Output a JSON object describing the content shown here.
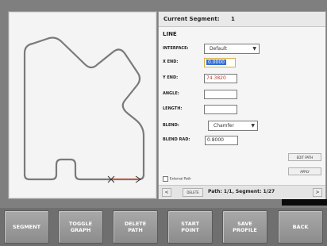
{
  "editor": {
    "current_segment_label": "Current Segment:",
    "current_segment_value": "1",
    "segment_type": "LINE",
    "fields": {
      "interface_label": "INTERFACE:",
      "interface_value": "Default",
      "x_end_label": "X END:",
      "x_end_value": "0.0000",
      "y_end_label": "Y END:",
      "y_end_value": "74.3820",
      "angle_label": "ANGLE:",
      "angle_value": "",
      "length_label": "LENGTH:",
      "length_value": "",
      "blend_label": "BLEND:",
      "blend_value": "Chamfer",
      "blend_rad_label": "BLEND RAD:",
      "blend_rad_value": "0.8000"
    },
    "side_buttons": {
      "edit_path_label": "EDIT PATH",
      "apply_label": "APPLY"
    },
    "external_path_label": "External Path",
    "path_bar": {
      "prev_label": "<",
      "next_label": ">",
      "delete_label": "DELETE",
      "status": "Path: 1/1, Segment: 1/27"
    }
  },
  "bottom_buttons": [
    {
      "label": "SEGMENT"
    },
    {
      "label": "TOGGLE\nGRAPH"
    },
    {
      "label": "DELETE\nPATH"
    },
    {
      "label": "START\nPOINT"
    },
    {
      "label": "SAVE\nPROFILE"
    },
    {
      "label": "BACK"
    }
  ],
  "colors": {
    "path_line": "#7a7a7a",
    "active_segment": "#e0502a",
    "start_marker": "#333333",
    "selection": "#2f6fd6"
  }
}
